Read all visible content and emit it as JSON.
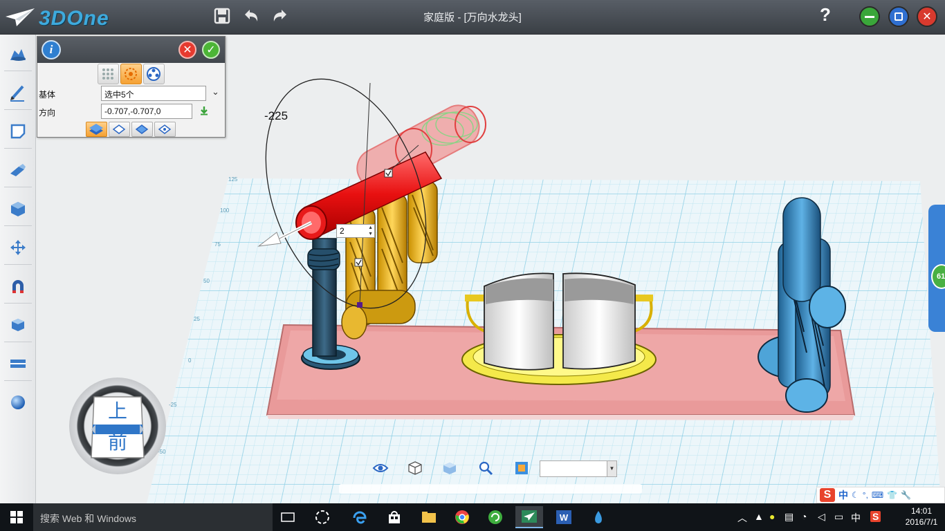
{
  "app": {
    "logo_text": "3DOne",
    "window_title": "家庭版 - [万向水龙头]",
    "help_label": "?"
  },
  "titlebar_icons": [
    "save-icon",
    "undo-icon",
    "redo-icon"
  ],
  "window_controls": [
    "minimize-icon",
    "restore-icon",
    "close-icon"
  ],
  "left_toolbar": {
    "items": [
      "basic-solid-icon",
      "sketch-icon",
      "sketch-edit-icon",
      "special-feature-icon",
      "feature-edit-icon",
      "base-edit-icon",
      "combine-icon",
      "assembly-icon",
      "measure-icon",
      "render-icon"
    ]
  },
  "panel": {
    "field1_label": "基体",
    "field1_value": "选中5个",
    "field2_label": "方向",
    "field2_value": "-0.707,-0.707,0",
    "close_label": "✕",
    "ok_label": "✓"
  },
  "viewport": {
    "angle_label": "-225",
    "spin_value": "2",
    "grid_ticks_left": [
      "125",
      "100",
      "75",
      "50",
      "25",
      "0"
    ],
    "grid_ticks_lower": [
      "-25",
      "-50"
    ]
  },
  "viewcube": {
    "top_label": "上",
    "front_label": "前"
  },
  "view_toolbar": {
    "icons": [
      "view-show-icon",
      "wireframe-icon",
      "shaded-icon",
      "zoom-icon",
      "render-view-icon"
    ],
    "dropdown_value": ""
  },
  "ime": {
    "logo": "S",
    "mode": "中",
    "icons": [
      "☾",
      "°,",
      "⌨",
      "👕",
      "🔧"
    ]
  },
  "side_badge": "61",
  "taskbar": {
    "search_placeholder": "搜索 Web 和 Windows",
    "clock_time": "14:01",
    "clock_date": "2016/7/1",
    "tray_ime": "中"
  }
}
